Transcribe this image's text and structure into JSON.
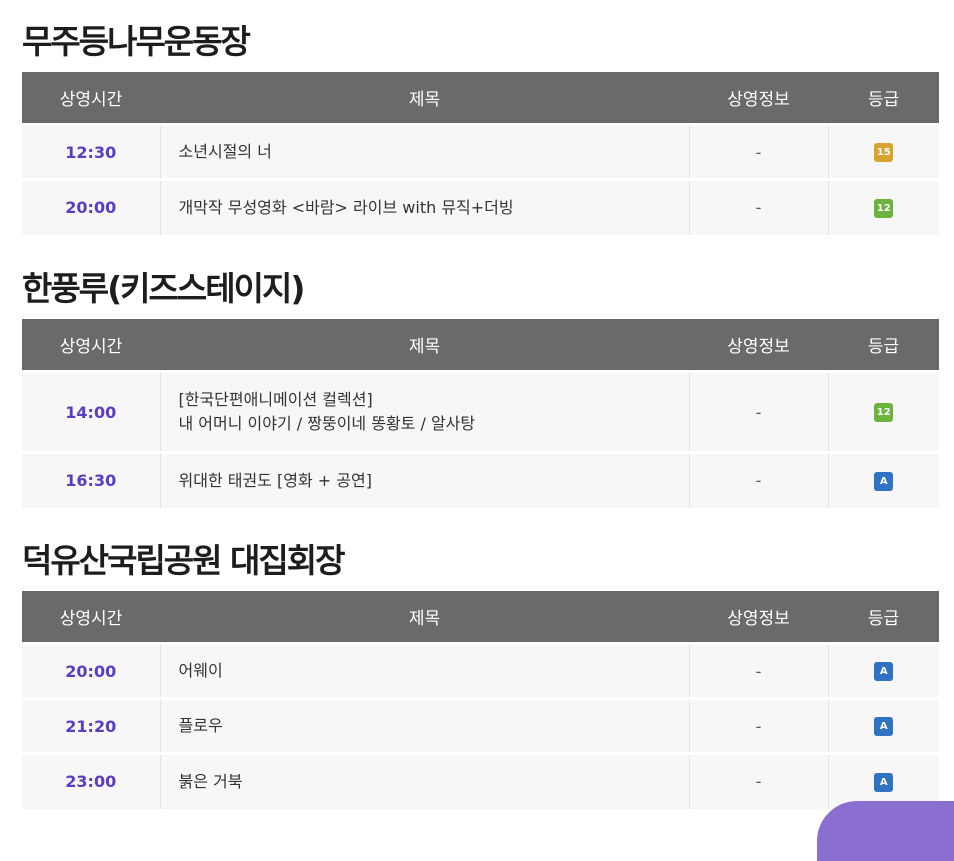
{
  "headers": {
    "time": "상영시간",
    "title": "제목",
    "info": "상영정보",
    "grade": "등급"
  },
  "grade_colors": {
    "15": "#d9a330",
    "12": "#6cb33e",
    "A": "#2f72c4"
  },
  "sections": [
    {
      "name": "무주등나무운동장",
      "rows": [
        {
          "time": "12:30",
          "title_lines": [
            "소년시절의 너"
          ],
          "info": "-",
          "grade": "15"
        },
        {
          "time": "20:00",
          "title_lines": [
            "개막작 무성영화 <바람> 라이브 with 뮤직+더빙"
          ],
          "info": "-",
          "grade": "12"
        }
      ]
    },
    {
      "name": "한풍루(키즈스테이지)",
      "rows": [
        {
          "time": "14:00",
          "title_lines": [
            "[한국단편애니메이션 컬렉션]",
            "내 어머니 이야기 / 짱뚱이네 똥황토 / 알사탕"
          ],
          "info": "-",
          "grade": "12"
        },
        {
          "time": "16:30",
          "title_lines": [
            "위대한 태권도 [영화 + 공연]"
          ],
          "info": "-",
          "grade": "A"
        }
      ]
    },
    {
      "name": "덕유산국립공원 대집회장",
      "rows": [
        {
          "time": "20:00",
          "title_lines": [
            "어웨이"
          ],
          "info": "-",
          "grade": "A"
        },
        {
          "time": "21:20",
          "title_lines": [
            "플로우"
          ],
          "info": "-",
          "grade": "A"
        },
        {
          "time": "23:00",
          "title_lines": [
            "붉은 거북"
          ],
          "info": "-",
          "grade": "A"
        }
      ]
    }
  ]
}
